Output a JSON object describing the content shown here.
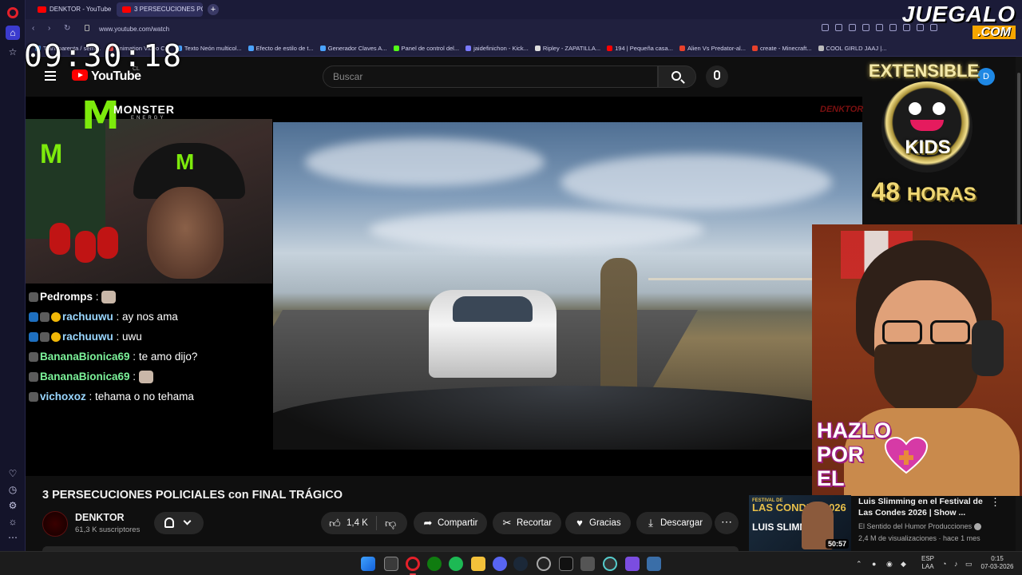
{
  "browser": {
    "tabs": [
      {
        "label": "DENKTOR - YouTube",
        "active": false
      },
      {
        "label": "3 PERSECUCIONES PO",
        "active": true
      }
    ],
    "new_tab": "+",
    "url": "www.youtube.com/watch",
    "bookmarks": [
      {
        "label": "Transparenta / semi...",
        "color": "#4aa3ff"
      },
      {
        "label": "Animation Video C...",
        "color": "#e04a4a"
      },
      {
        "label": "Texto Neón multicol...",
        "color": "#4aa3ff"
      },
      {
        "label": "Efecto de estilo de t...",
        "color": "#4aa3ff"
      },
      {
        "label": "Generador Claves A...",
        "color": "#4aa3ff"
      },
      {
        "label": "Panel de control del...",
        "color": "#53fc18"
      },
      {
        "label": "jaidefinichon - Kick...",
        "color": "#7a7aff"
      },
      {
        "label": "Ripley - ZAPATILLA...",
        "color": "#dddddd"
      },
      {
        "label": "194 | Pequeña casa...",
        "color": "#ff0000"
      },
      {
        "label": "Alien Vs Predator-al...",
        "color": "#e8412b"
      },
      {
        "label": "create - Minecraft...",
        "color": "#e8412b"
      },
      {
        "label": "COOL GIRLD JAAJ |...",
        "color": "#bbbbbb"
      }
    ]
  },
  "overlay": {
    "clock": "09:30:18",
    "brand_top": "JUEGALO",
    "brand_bottom": ".COM",
    "monster_word": "MONSTER",
    "monster_sub": "ENERGY",
    "dentor_mark": "DENKTOR",
    "extensible": "EXTENSIBLE",
    "kids": "KIDS",
    "hours_number": "48",
    "hours_word": "HORAS",
    "hazlo_lines": [
      "HAZLO",
      "POR",
      "EL"
    ],
    "chat": [
      {
        "user": "Pedromps",
        "color": "#ffffff",
        "badges": [
          "g"
        ],
        "msg": "",
        "emote": true
      },
      {
        "user": "rachuuwu",
        "color": "#9ad7ff",
        "badges": [
          "b",
          "g",
          "y"
        ],
        "msg": "ay nos ama",
        "emote": false
      },
      {
        "user": "rachuuwu",
        "color": "#9ad7ff",
        "badges": [
          "b",
          "g",
          "y"
        ],
        "msg": "uwu",
        "emote": false
      },
      {
        "user": "BananaBionica69",
        "color": "#7cf29a",
        "badges": [
          "g"
        ],
        "msg": "te amo dijo?",
        "emote": false
      },
      {
        "user": "BananaBionica69",
        "color": "#7cf29a",
        "badges": [
          "g"
        ],
        "msg": "",
        "emote": true
      },
      {
        "user": "vichoxoz",
        "color": "#9ad7ff",
        "badges": [
          "g"
        ],
        "msg": "tehama o no tehama",
        "emote": false
      }
    ]
  },
  "youtube": {
    "logo_text": "YouTube",
    "country": "CL",
    "search_placeholder": "Buscar",
    "account_initial": "D",
    "video_title": "3 PERSECUCIONES POLICIALES con FINAL TRÁGICO",
    "channel_name": "DENKTOR",
    "subscribers": "61,3 K suscriptores",
    "likes": "1,4 K",
    "actions": {
      "share": "Compartir",
      "clip": "Recortar",
      "thanks": "Gracias",
      "download": "Descargar"
    },
    "recommended": {
      "title": "Luis Slimming en el Festival de Las Condes 2026 | Show ...",
      "channel": "El Sentido del Humor Producciones",
      "meta": "2,4 M de visualizaciones · hace 1 mes",
      "duration": "50:57",
      "thumb_small": "FESTIVAL DE",
      "thumb_big": "LAS CONDES 2026",
      "thumb_name": "LUIS SLIMMING"
    }
  },
  "taskbar": {
    "lang_top": "ESP",
    "lang_bottom": "LAA",
    "time": "0:15",
    "date": "07-03-2026"
  }
}
